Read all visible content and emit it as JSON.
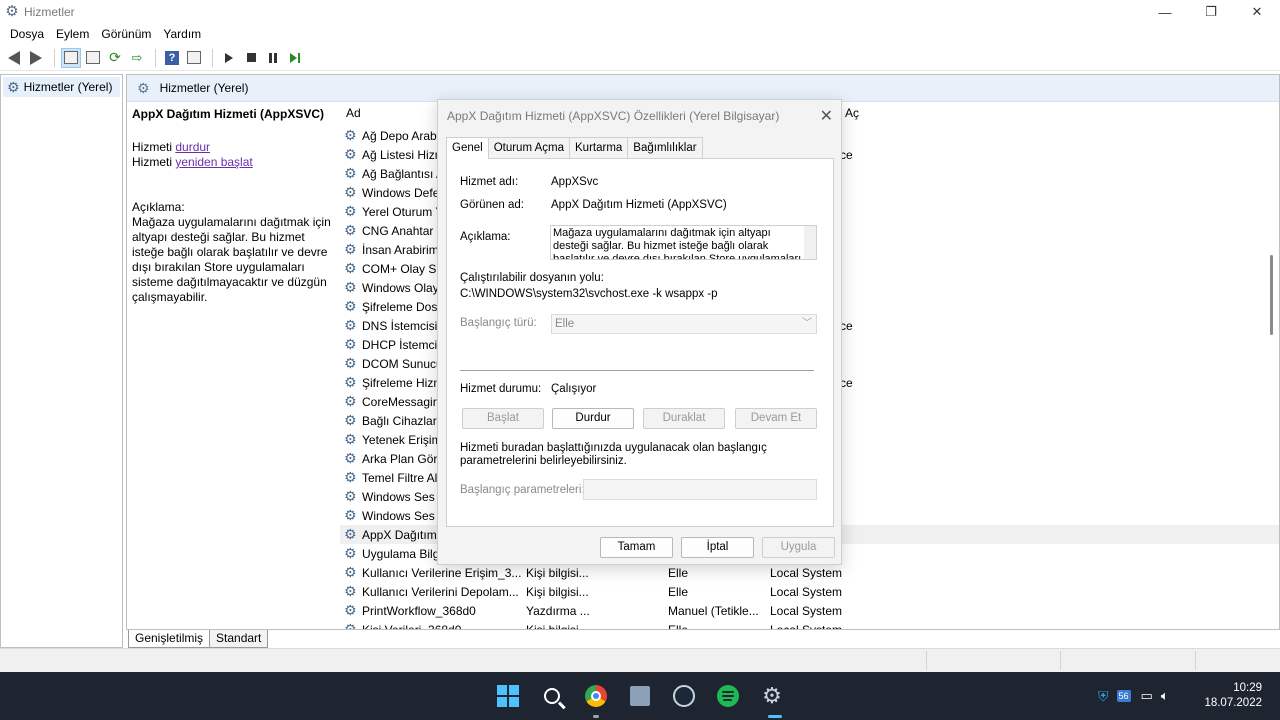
{
  "window": {
    "title": "Hizmetler",
    "minimize": "—",
    "maximize": "❐",
    "close": "✕"
  },
  "menu": [
    "Dosya",
    "Eylem",
    "Görünüm",
    "Yardım"
  ],
  "tree": {
    "root": "Hizmetler (Yerel)"
  },
  "main": {
    "header": "Hizmetler (Yerel)",
    "selected_service": {
      "title": "AppX Dağıtım Hizmeti (AppXSVC)",
      "stop_prefix": "Hizmeti ",
      "stop_link": "durdur",
      "restart_prefix": "Hizmeti ",
      "restart_link": "yeniden başlat",
      "desc_label": "Açıklama:",
      "description": "Mağaza uygulamalarını dağıtmak için altyapı desteği sağlar. Bu hizmet isteğe bağlı olarak başlatılır ve devre dışı bırakılan Store uygulamaları sisteme dağıtılmayacaktır ve düzgün çalışmayabilir."
    },
    "columns": {
      "name": "Ad",
      "startup": "Aç"
    },
    "rows": [
      {
        "name": "Ağ Depo Arabi",
        "desc": "",
        "start": "",
        "logon": "",
        "extra": ""
      },
      {
        "name": "Ağ Listesi Hizm",
        "desc": "",
        "start": "",
        "logon": "",
        "extra": "ce"
      },
      {
        "name": "Ağ Bağlantısı A",
        "desc": "",
        "start": "",
        "logon": "",
        "extra": ""
      },
      {
        "name": "Windows Defe",
        "desc": "",
        "start": "",
        "logon": "",
        "extra": ""
      },
      {
        "name": "Yerel Oturum Y",
        "desc": "",
        "start": "",
        "logon": "",
        "extra": ""
      },
      {
        "name": "CNG Anahtar Y",
        "desc": "",
        "start": "",
        "logon": "",
        "extra": ""
      },
      {
        "name": "İnsan Arabirim",
        "desc": "",
        "start": "",
        "logon": "",
        "extra": ""
      },
      {
        "name": "COM+ Olay Sis",
        "desc": "",
        "start": "",
        "logon": "",
        "extra": ""
      },
      {
        "name": "Windows Olay",
        "desc": "",
        "start": "",
        "logon": "",
        "extra": ""
      },
      {
        "name": "Şifreleme Dosy",
        "desc": "",
        "start": "",
        "logon": "",
        "extra": ""
      },
      {
        "name": "DNS İstemcisi",
        "desc": "",
        "start": "",
        "logon": "",
        "extra": "ce"
      },
      {
        "name": "DHCP İstemcis",
        "desc": "",
        "start": "",
        "logon": "",
        "extra": ""
      },
      {
        "name": "DCOM Sunucu",
        "desc": "",
        "start": "",
        "logon": "",
        "extra": ""
      },
      {
        "name": "Şifreleme Hizm",
        "desc": "",
        "start": "",
        "logon": "",
        "extra": "ce"
      },
      {
        "name": "CoreMessaging",
        "desc": "",
        "start": "",
        "logon": "",
        "extra": ""
      },
      {
        "name": "Bağlı Cihazlar P",
        "desc": "",
        "start": "",
        "logon": "",
        "extra": ""
      },
      {
        "name": "Yetenek Erişim",
        "desc": "",
        "start": "",
        "logon": "",
        "extra": ""
      },
      {
        "name": "Arka Plan Göre",
        "desc": "",
        "start": "",
        "logon": "",
        "extra": ""
      },
      {
        "name": "Temel Filtre Alt",
        "desc": "",
        "start": "",
        "logon": "",
        "extra": ""
      },
      {
        "name": "Windows Ses",
        "desc": "",
        "start": "",
        "logon": "",
        "extra": ""
      },
      {
        "name": "Windows Ses E",
        "desc": "",
        "start": "",
        "logon": "",
        "extra": ""
      },
      {
        "name": "AppX Dağıtım",
        "desc": "",
        "start": "",
        "logon": "",
        "extra": "",
        "selected": true
      },
      {
        "name": "Uygulama Bilg",
        "desc": "",
        "start": "",
        "logon": "",
        "extra": ""
      },
      {
        "name": "Kullanıcı Verilerine Erişim_3...",
        "desc": "Kişi bilgisi...",
        "start": "Elle",
        "logon": "Local System",
        "extra": ""
      },
      {
        "name": "Kullanıcı Verilerini Depolam...",
        "desc": "Kişi bilgisi...",
        "start": "Elle",
        "logon": "Local System",
        "extra": ""
      },
      {
        "name": "PrintWorkflow_368d0",
        "desc": "Yazdırma ...",
        "start": "Manuel (Tetikle...",
        "logon": "Local System",
        "extra": ""
      },
      {
        "name": "Kişi Verileri_368d0",
        "desc": "Kişi bilgisi...",
        "start": "Elle",
        "logon": "Local System",
        "extra": ""
      }
    ]
  },
  "bottom_tabs": [
    "Genişletilmiş",
    "Standart"
  ],
  "dialog": {
    "title": "AppX Dağıtım Hizmeti (AppXSVC) Özellikleri (Yerel Bilgisayar)",
    "tabs": [
      "Genel",
      "Oturum Açma",
      "Kurtarma",
      "Bağımlılıklar"
    ],
    "service_name_label": "Hizmet adı:",
    "service_name": "AppXSvc",
    "display_name_label": "Görünen ad:",
    "display_name": "AppX Dağıtım Hizmeti (AppXSVC)",
    "description_label": "Açıklama:",
    "description": "Mağaza uygulamalarını dağıtmak için altyapı desteği sağlar. Bu hizmet isteğe bağlı olarak başlatılır ve devre dışı bırakılan Store uygulamaları sisteme",
    "exe_label": "Çalıştırılabilir dosyanın yolu:",
    "exe_path": "C:\\WINDOWS\\system32\\svchost.exe -k wsappx -p",
    "startup_type_label": "Başlangıç türü:",
    "startup_type": "Elle",
    "status_label": "Hizmet durumu:",
    "status": "Çalışıyor",
    "btn_start": "Başlat",
    "btn_stop": "Durdur",
    "btn_pause": "Duraklat",
    "btn_resume": "Devam Et",
    "hint": "Hizmeti buradan başlattığınızda uygulanacak olan başlangıç parametrelerini belirleyebilirsiniz.",
    "params_label": "Başlangıç parametreleri:",
    "btn_ok": "Tamam",
    "btn_cancel": "İptal",
    "btn_apply": "Uygula"
  },
  "taskbar": {
    "tray_badge": "56",
    "time": "10:29",
    "date": "18.07.2022"
  },
  "colors": {
    "accent": "#4cc2ff",
    "link": "#6b2eaa",
    "header_bg": "#e8f1fa"
  }
}
